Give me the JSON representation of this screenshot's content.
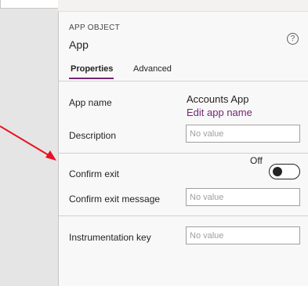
{
  "header": {
    "overline": "APP OBJECT",
    "title": "App",
    "help_icon": "help-icon"
  },
  "tabs": [
    {
      "label": "Properties",
      "active": true
    },
    {
      "label": "Advanced",
      "active": false
    }
  ],
  "properties": {
    "app_name_label": "App name",
    "app_name_value": "Accounts App",
    "edit_link": "Edit app name",
    "description_label": "Description",
    "description_placeholder": "No value",
    "confirm_exit_label": "Confirm exit",
    "confirm_exit_state": "Off",
    "confirm_exit_message_label": "Confirm exit message",
    "confirm_exit_message_placeholder": "No value",
    "instrumentation_key_label": "Instrumentation key",
    "instrumentation_key_placeholder": "No value"
  },
  "colors": {
    "accent": "#742774",
    "annotation_arrow": "#e81123"
  }
}
